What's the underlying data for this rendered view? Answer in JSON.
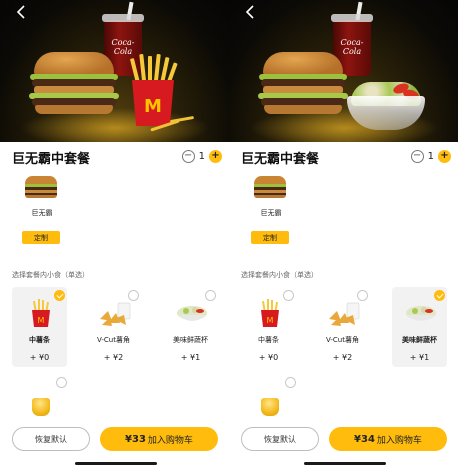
{
  "colors": {
    "accent": "#ffbc0d",
    "brand_red": "#d71920",
    "hero_bg": "#0c0a06"
  },
  "left_screen": {
    "back_icon": "chevron-left-icon",
    "hero": {
      "cola_logo_text": "Coca-Cola",
      "fries_logo_text": "M"
    },
    "title": "巨无霸中套餐",
    "quantity": "1",
    "main_item": {
      "label": "巨无霸",
      "customize_label": "定制"
    },
    "section_label": "选择套餐内小食（单选）",
    "options": [
      {
        "name": "中薯条",
        "price": "+ ¥0",
        "selected": true,
        "icon": "fries-icon"
      },
      {
        "name": "V-Cut薯角",
        "price": "+ ¥2",
        "selected": false,
        "icon": "potato-wedges-icon"
      },
      {
        "name": "美味鲜蔬杯",
        "price": "+ ¥1",
        "selected": false,
        "icon": "veggie-cup-icon"
      }
    ],
    "extra_option_icon": "corn-cup-icon",
    "reset_label": "恢复默认",
    "cart": {
      "amount": "¥33",
      "label": "加入购物车"
    }
  },
  "right_screen": {
    "back_icon": "chevron-left-icon",
    "hero": {
      "cola_logo_text": "Coca-Cola"
    },
    "title": "巨无霸中套餐",
    "quantity": "1",
    "main_item": {
      "label": "巨无霸",
      "customize_label": "定制"
    },
    "section_label": "选择套餐内小食（单选）",
    "options": [
      {
        "name": "中薯条",
        "price": "+ ¥0",
        "selected": false,
        "icon": "fries-icon"
      },
      {
        "name": "V-Cut薯角",
        "price": "+ ¥2",
        "selected": false,
        "icon": "potato-wedges-icon"
      },
      {
        "name": "美味鲜蔬杯",
        "price": "+ ¥1",
        "selected": true,
        "icon": "veggie-cup-icon"
      }
    ],
    "extra_option_icon": "corn-cup-icon",
    "reset_label": "恢复默认",
    "cart": {
      "amount": "¥34",
      "label": "加入购物车"
    }
  }
}
